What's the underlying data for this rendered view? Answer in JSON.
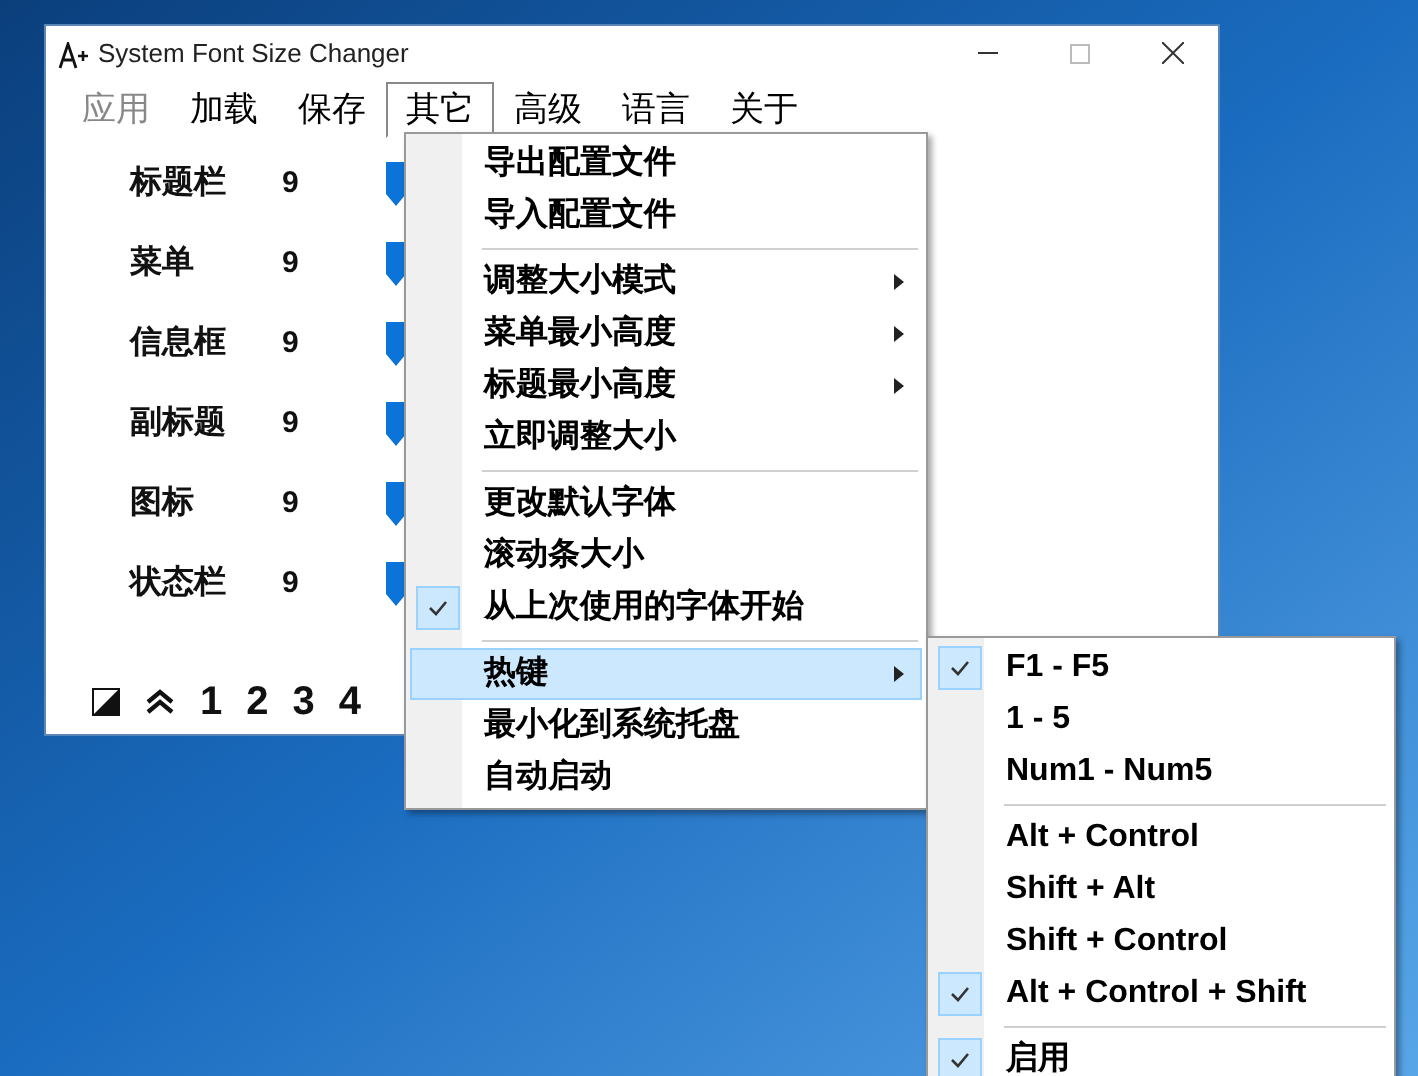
{
  "window": {
    "title": "System Font Size Changer"
  },
  "menu_bar": [
    {
      "label": "应用",
      "selected": false,
      "disabled": true
    },
    {
      "label": "加载",
      "selected": false,
      "disabled": false
    },
    {
      "label": "保存",
      "selected": false,
      "disabled": false
    },
    {
      "label": "其它",
      "selected": true,
      "disabled": false
    },
    {
      "label": "高级",
      "selected": false,
      "disabled": false
    },
    {
      "label": "语言",
      "selected": false,
      "disabled": false
    },
    {
      "label": "关于",
      "selected": false,
      "disabled": false
    }
  ],
  "font_rows": [
    {
      "label": "标题栏",
      "value": "9",
      "level": 0
    },
    {
      "label": "菜单",
      "value": "9",
      "level": 0
    },
    {
      "label": "信息框",
      "value": "9",
      "level": 0
    },
    {
      "label": "副标题",
      "value": "9",
      "level": 0
    },
    {
      "label": "图标",
      "value": "9",
      "level": 0
    },
    {
      "label": "状态栏",
      "value": "9",
      "level": 0
    }
  ],
  "presets": [
    "1",
    "2",
    "3",
    "4"
  ],
  "dropdown": [
    {
      "kind": "item",
      "label": "导出配置文件",
      "checked": false,
      "submenu": false,
      "selected": false
    },
    {
      "kind": "item",
      "label": "导入配置文件",
      "checked": false,
      "submenu": false,
      "selected": false
    },
    {
      "kind": "separator"
    },
    {
      "kind": "item",
      "label": "调整大小模式",
      "checked": false,
      "submenu": true,
      "selected": false
    },
    {
      "kind": "item",
      "label": "菜单最小高度",
      "checked": false,
      "submenu": true,
      "selected": false
    },
    {
      "kind": "item",
      "label": "标题最小高度",
      "checked": false,
      "submenu": true,
      "selected": false
    },
    {
      "kind": "item",
      "label": "立即调整大小",
      "checked": false,
      "submenu": false,
      "selected": false
    },
    {
      "kind": "separator"
    },
    {
      "kind": "item",
      "label": "更改默认字体",
      "checked": false,
      "submenu": false,
      "selected": false
    },
    {
      "kind": "item",
      "label": "滚动条大小",
      "checked": false,
      "submenu": false,
      "selected": false
    },
    {
      "kind": "item",
      "label": "从上次使用的字体开始",
      "checked": true,
      "submenu": false,
      "selected": false
    },
    {
      "kind": "separator"
    },
    {
      "kind": "item",
      "label": "热键",
      "checked": false,
      "submenu": true,
      "selected": true
    },
    {
      "kind": "item",
      "label": "最小化到系统托盘",
      "checked": false,
      "submenu": false,
      "selected": false
    },
    {
      "kind": "item",
      "label": "自动启动",
      "checked": false,
      "submenu": false,
      "selected": false
    }
  ],
  "hotkey_submenu": [
    {
      "kind": "item",
      "label": "F1 - F5",
      "checked": true
    },
    {
      "kind": "item",
      "label": "1 - 5",
      "checked": false
    },
    {
      "kind": "item",
      "label": "Num1 - Num5",
      "checked": false
    },
    {
      "kind": "separator"
    },
    {
      "kind": "item",
      "label": "Alt + Control",
      "checked": false
    },
    {
      "kind": "item",
      "label": "Shift + Alt",
      "checked": false
    },
    {
      "kind": "item",
      "label": "Shift + Control",
      "checked": false
    },
    {
      "kind": "item",
      "label": "Alt + Control + Shift",
      "checked": true
    },
    {
      "kind": "separator"
    },
    {
      "kind": "item",
      "label": "启用",
      "checked": true
    }
  ]
}
